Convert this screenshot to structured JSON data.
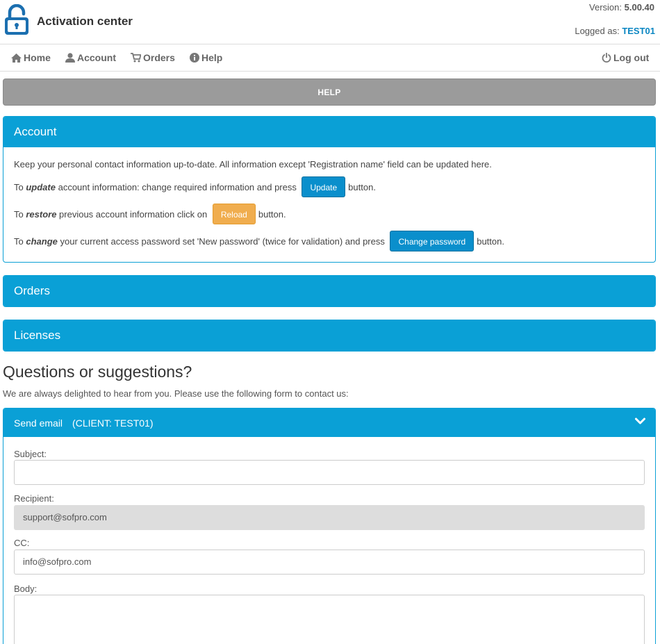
{
  "header": {
    "title": "Activation center",
    "version_label": "Version:",
    "version_value": "5.00.40",
    "logged_label": "Logged as:",
    "logged_user": "TEST01"
  },
  "nav": {
    "home": "Home",
    "account": "Account",
    "orders": "Orders",
    "help": "Help",
    "logout": "Log out"
  },
  "help_bar": "HELP",
  "account": {
    "title": "Account",
    "intro": "Keep your personal contact information up-to-date. All information except 'Registration name' field can be updated here.",
    "update_pre": "To ",
    "update_em": "update",
    "update_mid": " account information: change required information and press ",
    "update_button": "Update",
    "update_post": " button.",
    "restore_pre": "To ",
    "restore_em": "restore",
    "restore_mid": " previous account information click on ",
    "reload_button": "Reload",
    "restore_post": " button.",
    "change_pre": "To ",
    "change_em": "change",
    "change_mid": " your current access password set 'New password' (twice for validation) and press ",
    "change_button": "Change password",
    "change_post": " button."
  },
  "orders": {
    "title": "Orders"
  },
  "licenses": {
    "title": "Licenses"
  },
  "questions": {
    "title": "Questions or suggestions?",
    "subtitle": "We are always delighted to hear from you. Please use the following form to contact us:"
  },
  "email": {
    "title": "Send email",
    "client": "(CLIENT: TEST01)",
    "subject_label": "Subject:",
    "subject_value": "",
    "recipient_label": "Recipient:",
    "recipient_value": "support@sofpro.com",
    "cc_label": "CC:",
    "cc_value": "info@sofpro.com",
    "body_label": "Body:",
    "body_value": ""
  },
  "colors": {
    "primary": "#0aa0d6",
    "button_blue": "#0a8fcc",
    "button_orange": "#f0ad4e",
    "help_gray": "#9b9b9b"
  },
  "icons": {
    "logo": "padlock-icon",
    "home": "home-icon",
    "account": "user-icon",
    "orders": "cart-icon",
    "help": "info-icon",
    "logout": "power-icon",
    "collapse": "chevron-down-icon"
  }
}
